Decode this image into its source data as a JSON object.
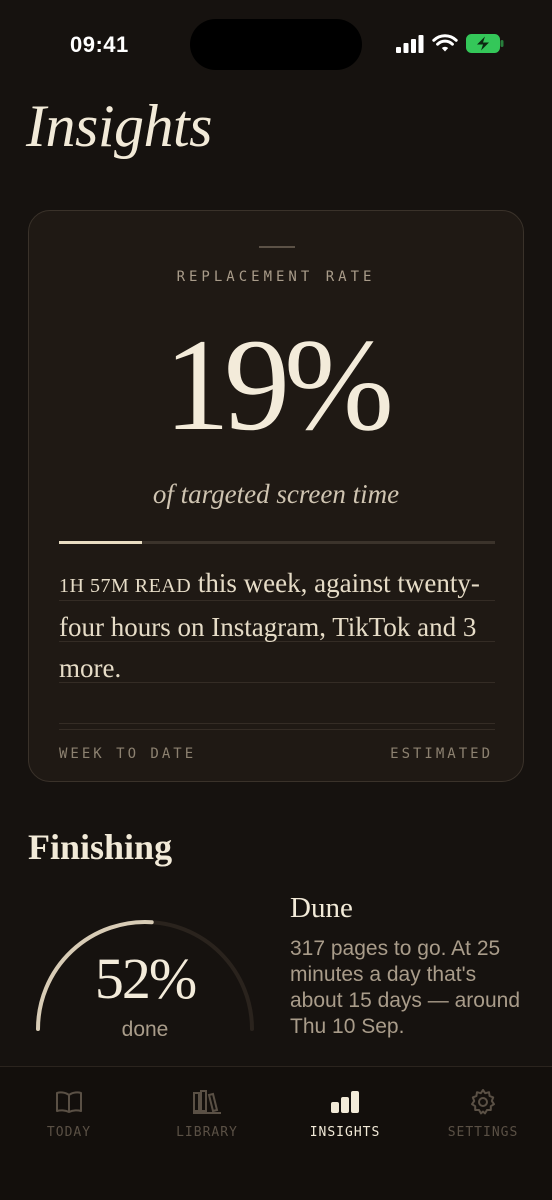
{
  "status_bar": {
    "time": "09:41"
  },
  "page": {
    "title": "Insights"
  },
  "replacement": {
    "label": "REPLACEMENT RATE",
    "value": "19%",
    "rate_fraction": 0.19,
    "subtitle": "of targeted screen time",
    "read_amount": "1H 57M READ",
    "summary": " this week, against twenty-four hours on Instagram, TikTok and 3 more.",
    "footer_left": "WEEK TO DATE",
    "footer_right": "ESTIMATED"
  },
  "finishing": {
    "title": "Finishing",
    "progress_value": "52%",
    "progress_fraction": 0.52,
    "progress_label": "done",
    "book_title": "Dune",
    "book_description": "317 pages to go. At 25 minutes a day that's about 15 days — around Thu 10 Sep."
  },
  "tabs": [
    {
      "label": "TODAY",
      "icon": "book-open-icon",
      "active": false
    },
    {
      "label": "LIBRARY",
      "icon": "bookshelf-icon",
      "active": false
    },
    {
      "label": "INSIGHTS",
      "icon": "bar-chart-icon",
      "active": true
    },
    {
      "label": "SETTINGS",
      "icon": "gear-icon",
      "active": false
    }
  ],
  "colors": {
    "background": "#16120f",
    "card": "#1f1914",
    "accent": "#e8dcc2",
    "battery": "#34c759"
  }
}
